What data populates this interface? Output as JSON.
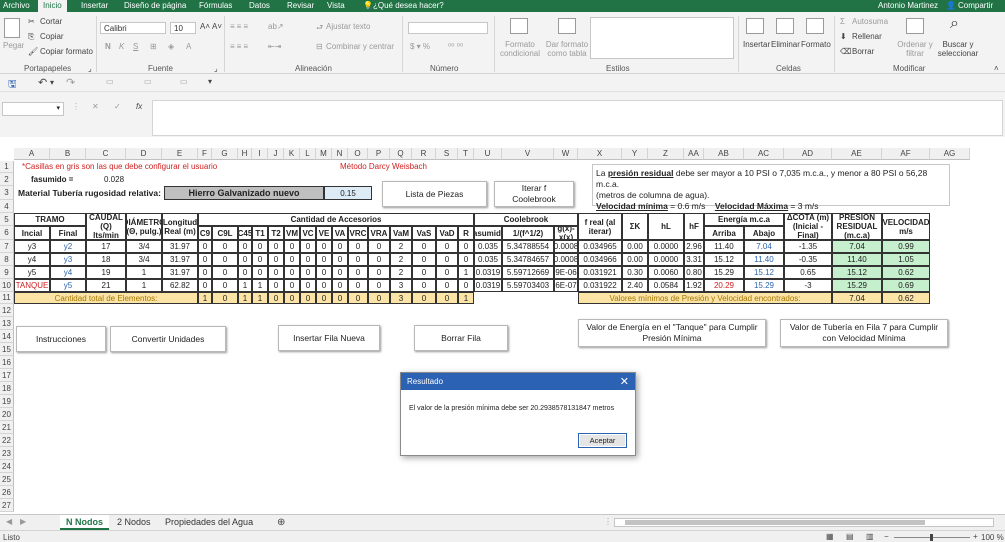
{
  "menu": {
    "file": "Archivo",
    "home": "Inicio",
    "insert": "Insertar",
    "layout": "Diseño de página",
    "formulas": "Fórmulas",
    "data": "Datos",
    "review": "Revisar",
    "view": "Vista",
    "tell": "¿Qué desea hacer?",
    "user": "Antonio Martinez",
    "share": "Compartir"
  },
  "ribbon": {
    "paste": "Pegar",
    "cut": "Cortar",
    "copy": "Copiar",
    "copy_format": "Copiar formato",
    "font": "Calibri",
    "size": "10",
    "bold": "N",
    "italic": "K",
    "underline": "S",
    "wrap": "Ajustar texto",
    "merge": "Combinar y centrar",
    "cond_format": "Formato condicional",
    "table_format": "Dar formato como tabla",
    "insert": "Insertar",
    "delete": "Eliminar",
    "format": "Formato",
    "autosum": "Autosuma",
    "fill": "Rellenar",
    "clear": "Borrar",
    "sort": "Ordenar y filtrar",
    "find": "Buscar y seleccionar",
    "groups": {
      "clipboard": "Portapapeles",
      "font": "Fuente",
      "alignment": "Alineación",
      "number": "Número",
      "styles": "Estilos",
      "cells": "Celdas",
      "editing": "Modificar"
    }
  },
  "colheaders": [
    "A",
    "B",
    "C",
    "D",
    "E",
    "F",
    "G",
    "H",
    "I",
    "J",
    "K",
    "L",
    "M",
    "N",
    "O",
    "P",
    "Q",
    "R",
    "S",
    "T",
    "U",
    "V",
    "W",
    "X",
    "Y",
    "Z",
    "AA",
    "AB",
    "AC",
    "AD",
    "AE",
    "AF",
    "AG"
  ],
  "rows": [
    "1",
    "2",
    "3",
    "4",
    "5",
    "6",
    "7",
    "8",
    "9",
    "10",
    "11",
    "12",
    "13",
    "14",
    "15",
    "16",
    "17",
    "18",
    "19",
    "20",
    "21",
    "22",
    "23",
    "24",
    "25",
    "26",
    "27"
  ],
  "top": {
    "note": "*Casillas en gris son las que debe configurar el usuario",
    "method": "Método Darcy Weisbach",
    "fasumido_label": "fasumido =",
    "fasumido_val": "0.028",
    "material_label": "Material Tubería rugosidad relativa:",
    "material_val": "Hierro Galvanizado nuevo",
    "material_num": "0.15",
    "btn_pieces": "Lista de Piezas",
    "btn_iterate": "Iterar f Coolebrook"
  },
  "info": {
    "l1a": "La ",
    "l1b": "presión residual",
    "l1c": " debe ser mayor a 10 PSI o 7,035 m.c.a., y menor a 80 PSI o 56,28 m.c.a.",
    "l2": "(metros de columna de agua).",
    "l3a": "Velocidad mínima",
    "l3b": " = 0.6 m/s",
    "l3c": "Velocidad Máxima",
    "l3d": " = 3 m/s"
  },
  "headers": {
    "tramo": "TRAMO",
    "inicial": "Incial",
    "final": "Final",
    "caudal": "CAUDAL (Q) lts/min",
    "diam": "DIÁMETRO (Θ, pulg.)",
    "long": "Longitud Real (m)",
    "accesorios": "Cantidad de Accesorios",
    "acc": [
      "C9",
      "C9L",
      "C45",
      "T1",
      "T2",
      "VM",
      "VC",
      "VE",
      "VA",
      "VRC",
      "VRA",
      "VaM",
      "VaS",
      "VaD",
      "R"
    ],
    "coolebrook": "Coolebrook",
    "fasum": "fasumido",
    "inv": "1/(f^1/2)",
    "gx": "g(x)-x(x)",
    "freal": "f real (al iterar)",
    "sk": "ΣK",
    "hl": "hL",
    "hf": "hF",
    "energia": "Energía m.c.a",
    "arriba": "Arriba",
    "abajo": "Abajo",
    "dcota": "ΔCOTA (m) (Inicial - Final)",
    "presion": "PRESIÓN RESIDUAL (m.c.a)",
    "vel": "VELOCIDAD m/s"
  },
  "data": [
    {
      "ini": "y3",
      "fin": "y2",
      "q": "17",
      "d": "3/4",
      "l": "31.97",
      "acc": [
        "0",
        "0",
        "0",
        "0",
        "0",
        "0",
        "0",
        "0",
        "0",
        "0",
        "0",
        "2",
        "0",
        "0",
        "0"
      ],
      "fa": "0.035",
      "inv": "5.34788554",
      "gx": "0.0008",
      "fr": "0.034965",
      "sk": "0.00",
      "hl": "0.0000",
      "hf": "2.96",
      "ar": "11.40",
      "ab": "7.04",
      "dc": "-1.35",
      "p": "7.04",
      "v": "0.99"
    },
    {
      "ini": "y4",
      "fin": "y3",
      "q": "18",
      "d": "3/4",
      "l": "31.97",
      "acc": [
        "0",
        "0",
        "0",
        "0",
        "0",
        "0",
        "0",
        "0",
        "0",
        "0",
        "0",
        "2",
        "0",
        "0",
        "0"
      ],
      "fa": "0.035",
      "inv": "5.34784657",
      "gx": "0.0008",
      "fr": "0.034966",
      "sk": "0.00",
      "hl": "0.0000",
      "hf": "3.31",
      "ar": "15.12",
      "ab": "11.40",
      "dc": "-0.35",
      "p": "11.40",
      "v": "1.05"
    },
    {
      "ini": "y5",
      "fin": "y4",
      "q": "19",
      "d": "1",
      "l": "31.97",
      "acc": [
        "0",
        "0",
        "0",
        "0",
        "0",
        "0",
        "0",
        "0",
        "0",
        "0",
        "0",
        "2",
        "0",
        "0",
        "1"
      ],
      "fa": "0.0319",
      "inv": "5.59712669",
      "gx": "9E-06",
      "fr": "0.031921",
      "sk": "0.30",
      "hl": "0.0060",
      "hf": "0.80",
      "ar": "15.29",
      "ab": "15.12",
      "dc": "0.65",
      "p": "15.12",
      "v": "0.62"
    },
    {
      "ini": "TANQUE",
      "fin": "y5",
      "q": "21",
      "d": "1",
      "l": "62.82",
      "acc": [
        "0",
        "0",
        "1",
        "1",
        "0",
        "0",
        "0",
        "0",
        "0",
        "0",
        "0",
        "3",
        "0",
        "0",
        "0"
      ],
      "fa": "0.0319",
      "inv": "5.59703403",
      "gx": "6E-07",
      "fr": "0.031922",
      "sk": "2.40",
      "hl": "0.0584",
      "hf": "1.92",
      "ar": "20.29",
      "ab": "15.29",
      "dc": "-3",
      "p": "15.29",
      "v": "0.69"
    }
  ],
  "totals": {
    "label": "Cantidad total de Elementos:",
    "acc": [
      "1",
      "0",
      "1",
      "1",
      "0",
      "0",
      "0",
      "0",
      "0",
      "0",
      "0",
      "3",
      "0",
      "0",
      "1"
    ],
    "min_label": "Valores mínimos de Presión y Velocidad encontrados:",
    "min_p": "7.04",
    "min_v": "0.62"
  },
  "buttons": {
    "instr": "Instrucciones",
    "convert": "Convertir Unidades",
    "insert_row": "Insertar Fila Nueva",
    "delete_row": "Borrar Fila",
    "energy": "Valor de Energía en el \"Tanque\" para Cumplir Presión Mínima",
    "pipe": "Valor de Tubería en Fila 7 para Cumplir con Velocidad Mínima"
  },
  "dialog": {
    "title": "Resultado",
    "message": "El valor de la presión mínima debe ser 20.2938578131847 metros",
    "ok": "Aceptar"
  },
  "sheets": [
    "N Nodos",
    "2 Nodos",
    "Propiedades del Agua"
  ],
  "status": {
    "ready": "Listo",
    "zoom": "100 %"
  },
  "colors": {
    "excel_green": "#217346",
    "dialog_blue": "#2b62b3",
    "result_green": "#c6efce",
    "total_yellow": "#fce4a6"
  }
}
